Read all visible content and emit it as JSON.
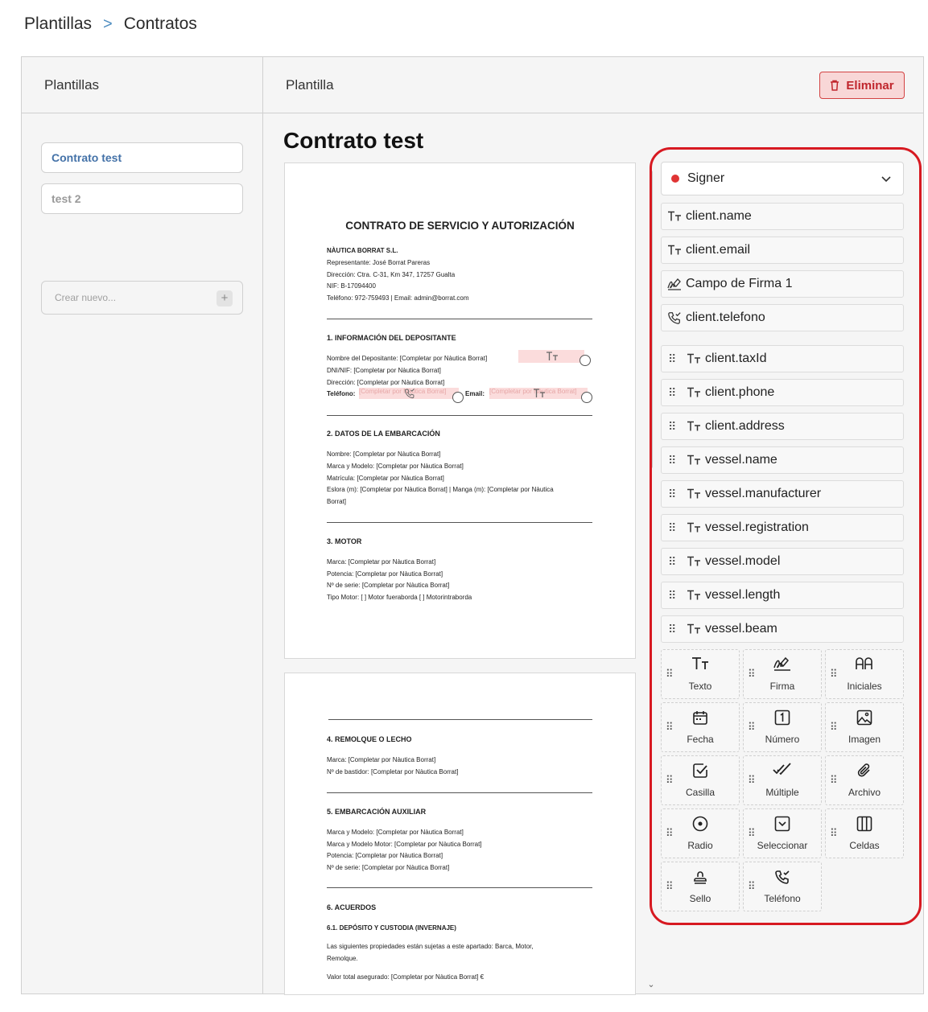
{
  "breadcrumb": {
    "parent": "Plantillas",
    "separator": ">",
    "current": "Contratos"
  },
  "left_panel": {
    "title": "Plantillas",
    "templates": [
      {
        "label": "Contrato test",
        "active": true
      },
      {
        "label": "test 2",
        "active": false
      }
    ],
    "new_placeholder": "Crear nuevo...",
    "new_icon": "+"
  },
  "main": {
    "header": "Plantilla",
    "delete_label": "Eliminar",
    "doc_title": "Contrato test",
    "page1": {
      "title": "CONTRATO DE SERVICIO Y AUTORIZACIÓN",
      "lines": [
        "NÀUTICA BORRAT S.L.",
        "Representante: José Borrat Pareras",
        "Dirección: Ctra. C-31, Km 347, 17257 Gualta",
        "NIF: B-17094400",
        "Teléfono: 972-759493 | Email: admin@borrat.com"
      ],
      "sec1": "1. INFORMACIÓN DEL DEPOSITANTE",
      "sec1_lines": [
        "Nombre del Depositante: [Completar por Nàutica Borrat]",
        "DNI/NIF: [Completar por Nàutica Borrat]",
        "Dirección: [Completar por Nàutica Borrat]",
        "Teléfono:"
      ],
      "email_label": "Email:",
      "field_placeholder": "[Completar por Nàutica Borrat]",
      "sec2": "2. DATOS DE LA EMBARCACIÓN",
      "sec2_lines": [
        "Nombre: [Completar por Nàutica Borrat]",
        "Marca y Modelo: [Completar por Nàutica Borrat]",
        "Matrícula: [Completar por Nàutica Borrat]",
        "Eslora (m): [Completar por Nàutica Borrat] | Manga (m): [Completar por Nàutica",
        "Borrat]"
      ],
      "sec3": "3. MOTOR",
      "sec3_lines": [
        "Marca: [Completar por Nàutica Borrat]",
        "Potencia: [Completar por Nàutica Borrat]",
        "Nº de serie: [Completar por Nàutica Borrat]",
        "Tipo Motor: [ ] Motor fueraborda [ ] Motorintraborda"
      ]
    },
    "page2": {
      "sec4": "4. REMOLQUE O LECHO",
      "sec4_lines": [
        "Marca:  [Completar por Nàutica Borrat]",
        "Nº de bastidor: [Completar por Nàutica Borrat]"
      ],
      "sec5": "5. EMBARCACIÓN AUXILIAR",
      "sec5_lines": [
        "Marca y Modelo: [Completar por Nàutica Borrat]",
        "Marca y Modelo Motor: [Completar por Nàutica Borrat]",
        "Potencia: [Completar por Nàutica Borrat]",
        "Nº de serie: [Completar por Nàutica Borrat]"
      ],
      "sec6": "6. ACUERDOS",
      "sec6_sub": "6.1. DEPÓSITO Y CUSTODIA (INVERNAJE)",
      "sec6_lines": [
        "Las siguientes propiedades están sujetas a este apartado: Barca, Motor,",
        "Remolque.",
        "Valor total asegurado: [Completar por Nàutica Borrat] €"
      ]
    }
  },
  "fields_panel": {
    "signer": "Signer",
    "signer_color": "#e03434",
    "placed_fields": [
      {
        "label": "client.name",
        "icon": "text-icon"
      },
      {
        "label": "client.email",
        "icon": "text-icon"
      },
      {
        "label": "Campo de Firma 1",
        "icon": "signature-icon"
      },
      {
        "label": "client.telefono",
        "icon": "phone-icon"
      }
    ],
    "available_fields": [
      {
        "label": "client.taxId"
      },
      {
        "label": "client.phone"
      },
      {
        "label": "client.address"
      },
      {
        "label": "vessel.name"
      },
      {
        "label": "vessel.manufacturer"
      },
      {
        "label": "vessel.registration"
      },
      {
        "label": "vessel.model"
      },
      {
        "label": "vessel.length"
      },
      {
        "label": "vessel.beam"
      }
    ],
    "field_types": [
      {
        "label": "Texto",
        "icon": "text-icon"
      },
      {
        "label": "Firma",
        "icon": "signature-icon"
      },
      {
        "label": "Iniciales",
        "icon": "initials-icon"
      },
      {
        "label": "Fecha",
        "icon": "calendar-icon"
      },
      {
        "label": "Número",
        "icon": "number-icon"
      },
      {
        "label": "Imagen",
        "icon": "image-icon"
      },
      {
        "label": "Casilla",
        "icon": "checkbox-icon"
      },
      {
        "label": "Múltiple",
        "icon": "multiple-check-icon"
      },
      {
        "label": "Archivo",
        "icon": "paperclip-icon"
      },
      {
        "label": "Radio",
        "icon": "radio-icon"
      },
      {
        "label": "Seleccionar",
        "icon": "select-icon"
      },
      {
        "label": "Celdas",
        "icon": "cells-icon"
      },
      {
        "label": "Sello",
        "icon": "stamp-icon"
      },
      {
        "label": "Teléfono",
        "icon": "phone-icon"
      }
    ]
  }
}
